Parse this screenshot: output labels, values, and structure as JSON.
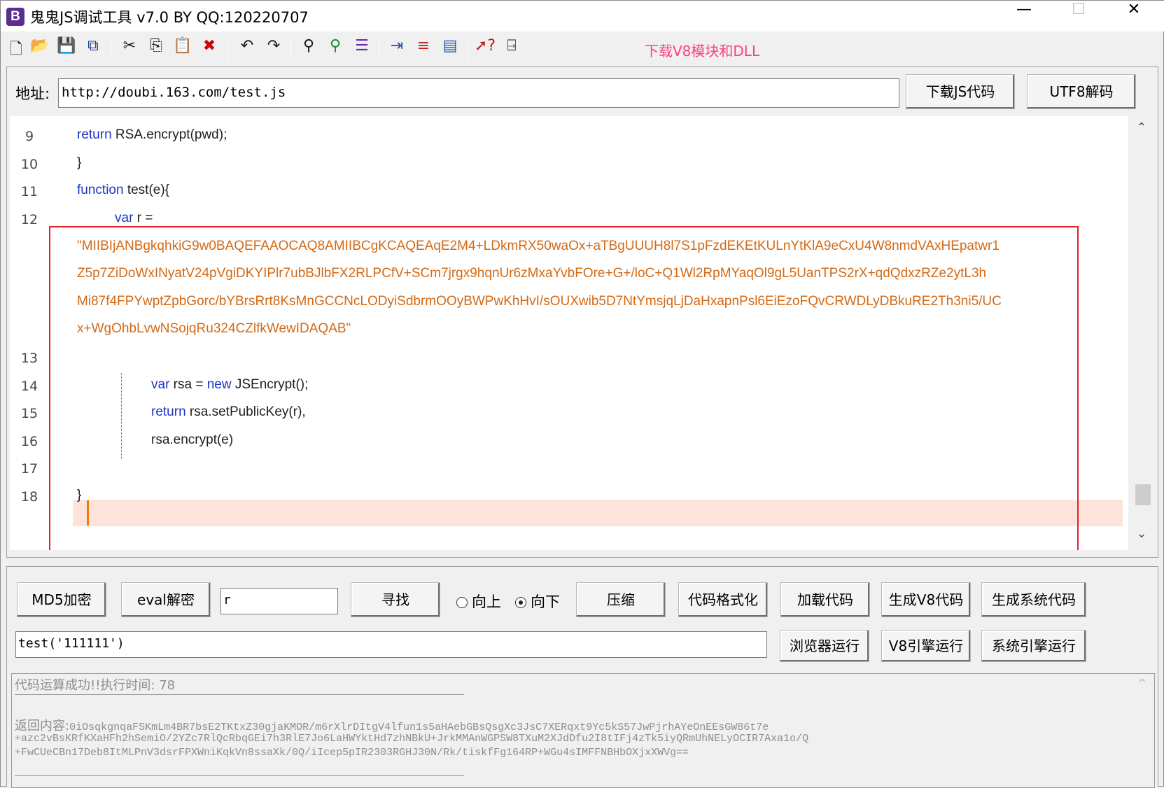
{
  "window": {
    "title": "鬼鬼JS调试工具 v7.0 BY QQ:120220707",
    "icon_letter": "B",
    "min": "—",
    "max": "☐",
    "close": "✕"
  },
  "toolbar": {
    "icons": [
      "new-file-icon",
      "open-folder-icon",
      "save-icon",
      "save-all-icon",
      "cut-icon",
      "copy-icon",
      "paste-icon",
      "delete-icon",
      "undo-icon",
      "redo-icon",
      "find-icon",
      "find-next-icon",
      "replace-icon",
      "indent-icon",
      "numbered-list-icon",
      "window-icon",
      "help-pointer-icon",
      "exit-icon"
    ],
    "download_link": "下载V8模块和DLL"
  },
  "address": {
    "label": "地址:",
    "value": "http://doubi.163.com/test.js",
    "download_button": "下载JS代码",
    "utf8_button": "UTF8解码"
  },
  "editor": {
    "line_numbers": [
      "9",
      "10",
      "11",
      "12",
      "13",
      "14",
      "15",
      "16",
      "17",
      "18"
    ],
    "lines": {
      "l9_kw": "return",
      "l9_rest": " RSA.encrypt(pwd);",
      "l10": "}",
      "l11_kw": "function",
      "l11_rest": " test(e){",
      "l12_kw": "var",
      "l12_rest": " r =",
      "l12_str1": "\"MIIBIjANBgkqhkiG9w0BAQEFAAOCAQ8AMIIBCgKCAQEAqE2M4+LDkmRX50waOx+aTBgUUUH8l7S1pFzdEKEtKULnYtKlA9eCxU4W8nmdVAxHEpatwr1",
      "l12_str2": "Z5p7ZiDoWxINyatV24pVgiDKYIPlr7ubBJlbFX2RLPCfV+SCm7jrgx9hqnUr6zMxaYvbFOre+G+/loC+Q1Wl2RpMYaqOl9gL5UanTPS2rX+qdQdxzRZe2ytL3h",
      "l12_str3": "Mi87f4FPYwptZpbGorc/bYBrsRrt8KsMnGCCNcLODyiSdbrmOOyBWPwKhHvI/sOUXwib5D7NtYmsjqLjDaHxapnPsl6EiEzoFQvCRWDLyDBkuRE2Th3ni5/UC",
      "l12_str4": "x+WgOhbLvwNSojqRu324CZlfkWewIDAQAB\"",
      "l14_kw1": "var",
      "l14_mid": " rsa = ",
      "l14_kw2": "new",
      "l14_rest": " JSEncrypt();",
      "l15_kw": "return",
      "l15_rest": " rsa.setPublicKey(r),",
      "l16": "rsa.encrypt(e)",
      "l18": "}"
    },
    "scroll_up": "⌃",
    "scroll_down": "⌄"
  },
  "controls": {
    "md5_button": "MD5加密",
    "eval_button": "eval解密",
    "search_value": "r",
    "find_button": "寻找",
    "radio_up": "向上",
    "radio_down": "向下",
    "radio_selected": "向下",
    "compress_button": "压缩",
    "format_button": "代码格式化",
    "load_button": "加载代码",
    "gen_v8_button": "生成V8代码",
    "gen_sys_button": "生成系统代码",
    "command_value": "test('111111')",
    "browser_run_button": "浏览器运行",
    "v8_run_button": "V8引擎运行",
    "sys_run_button": "系统引擎运行"
  },
  "output": {
    "status_label": "代码运算成功!!执行时间:",
    "status_time": "78",
    "result_label": "返回内容:",
    "result_line1": "0iOsqkgnqaFSKmLm4BR7bsE2TKtxZ30gjaKMOR/m6rXlrDItgV4lfun1s5aHAebGBsQsgXc3JsC7XERqxt9Yc5kS57JwPjrhAYeOnEEsGW86t7e",
    "result_line2": "+azc2vBsKRfKXaHFh2hSemiO/2YZc7RlQcRbqGEi7h3RlE7Jo6LaHWYktHd7zhNBkU+JrkMMAnWGPSW8TXuM2XJdDfu2I8tIFj4zTk5iyQRmUhNELyOCIR7Axa1o/Q",
    "result_line3": "+FwCUeCBn17Deb8ItMLPnV3dsrFPXWniKqkVn8ssaXk/0Q/iIcep5pIR2303RGHJ30N/Rk/tiskfFg164RP+WGu4sIMFFNBHbOXjxXWVg=="
  }
}
